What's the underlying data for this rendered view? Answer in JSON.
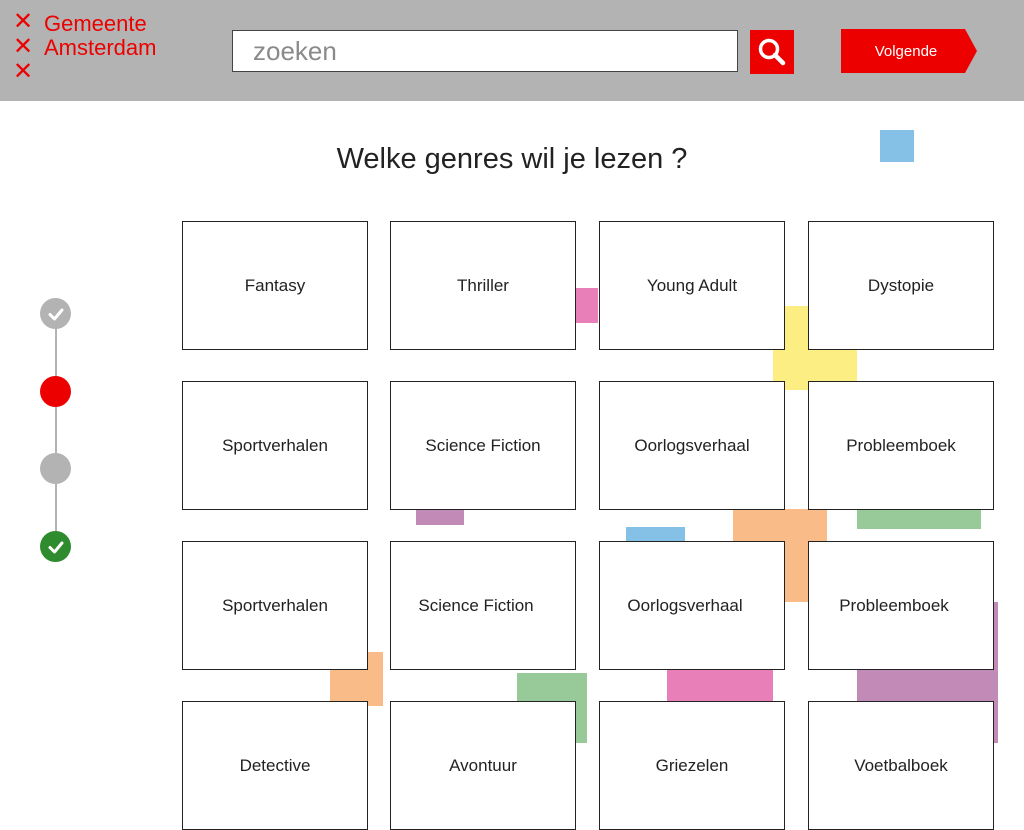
{
  "header": {
    "logo_marks": [
      "✕",
      "✕",
      "✕"
    ],
    "logo_line1": "Gemeente",
    "logo_line2": "Amsterdam",
    "search_placeholder": "zoeken",
    "next_label": "Volgende"
  },
  "title": "Welke genres wil je lezen ?",
  "stepper": {
    "steps": [
      {
        "state": "done",
        "color": "#b3b3b3"
      },
      {
        "state": "current",
        "color": "#ec0000"
      },
      {
        "state": "pending",
        "color": "#b3b3b3"
      },
      {
        "state": "complete",
        "color": "#2e8b2e"
      }
    ]
  },
  "genres": [
    [
      "Fantasy",
      "Thriller",
      "Young Adult",
      "Dystopie"
    ],
    [
      "Sportverhalen",
      "Science Fiction",
      "Oorlogsverhaal",
      "Probleemboek"
    ],
    [
      "Sportverhalen",
      "Science Fiction",
      "Oorlogsverhaal",
      "Probleemboek"
    ],
    [
      "Detective",
      "Avontuur",
      "Griezelen",
      "Voetbalboek"
    ]
  ],
  "colors": {
    "brand_red": "#ec0000",
    "header_gray": "#b3b3b3",
    "deco_blue": "#85c1e6",
    "deco_pink": "#e97fb8",
    "deco_yellow": "#fdee83",
    "deco_purple": "#c28bb7",
    "deco_orange": "#f9bb87",
    "deco_green": "#97c999"
  }
}
